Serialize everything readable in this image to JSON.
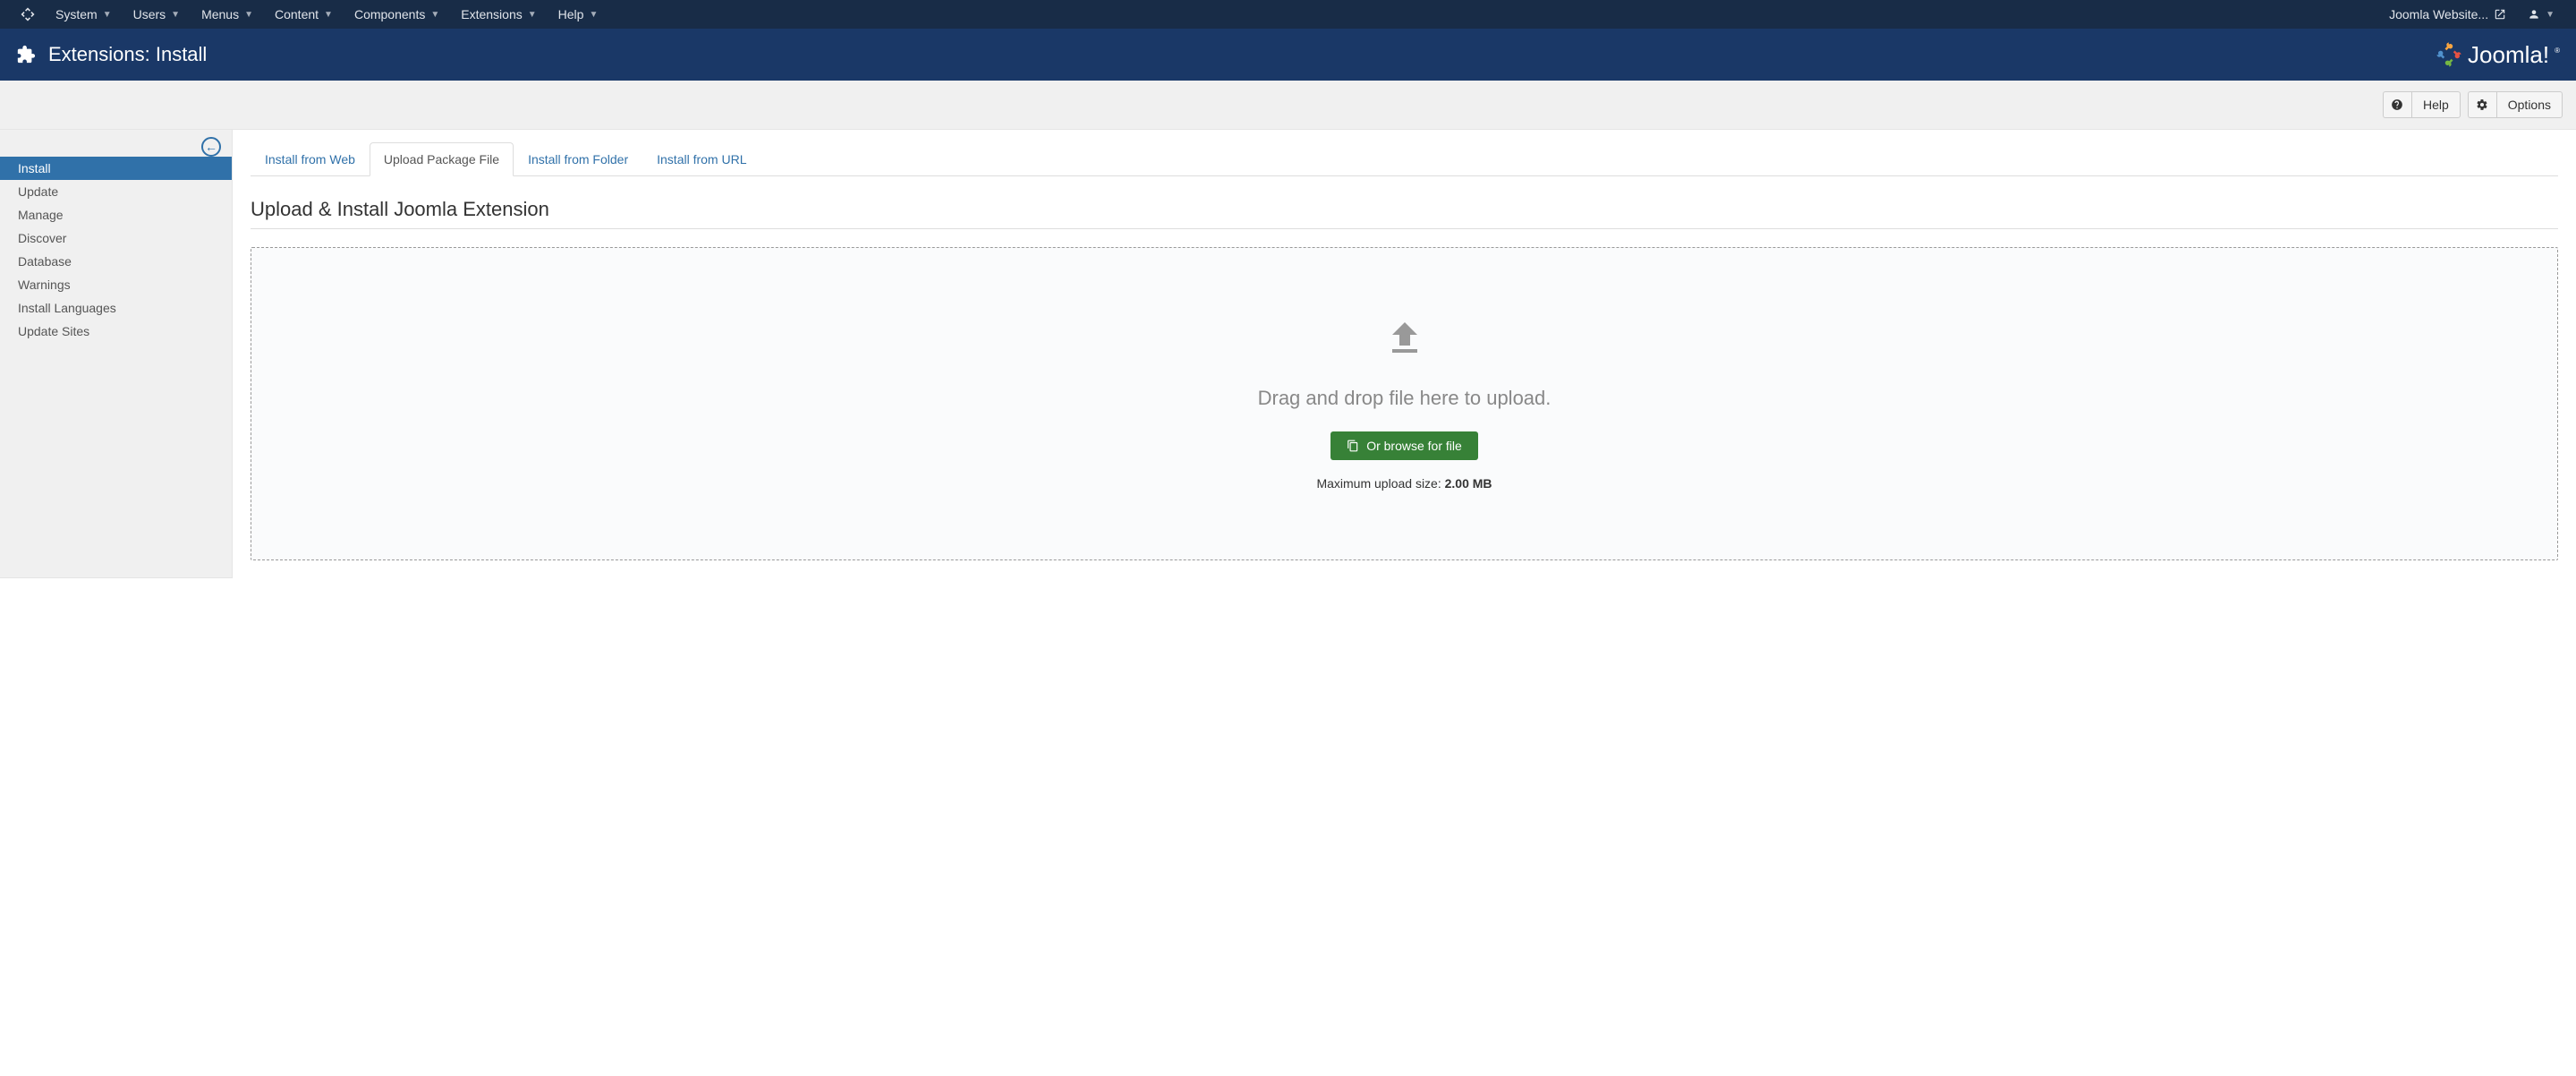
{
  "topnav": {
    "items": [
      "System",
      "Users",
      "Menus",
      "Content",
      "Components",
      "Extensions",
      "Help"
    ],
    "site_link": "Joomla Website..."
  },
  "header": {
    "title": "Extensions: Install",
    "brand": "Joomla!"
  },
  "toolbar": {
    "help": "Help",
    "options": "Options"
  },
  "sidebar": {
    "items": [
      {
        "label": "Install",
        "active": true
      },
      {
        "label": "Update",
        "active": false
      },
      {
        "label": "Manage",
        "active": false
      },
      {
        "label": "Discover",
        "active": false
      },
      {
        "label": "Database",
        "active": false
      },
      {
        "label": "Warnings",
        "active": false
      },
      {
        "label": "Install Languages",
        "active": false
      },
      {
        "label": "Update Sites",
        "active": false
      }
    ]
  },
  "tabs": [
    {
      "label": "Install from Web",
      "active": false
    },
    {
      "label": "Upload Package File",
      "active": true
    },
    {
      "label": "Install from Folder",
      "active": false
    },
    {
      "label": "Install from URL",
      "active": false
    }
  ],
  "content": {
    "title": "Upload & Install Joomla Extension",
    "drop_text": "Drag and drop file here to upload.",
    "browse_button": "Or browse for file",
    "max_upload_label": "Maximum upload size: ",
    "max_upload_value": "2.00 MB"
  }
}
